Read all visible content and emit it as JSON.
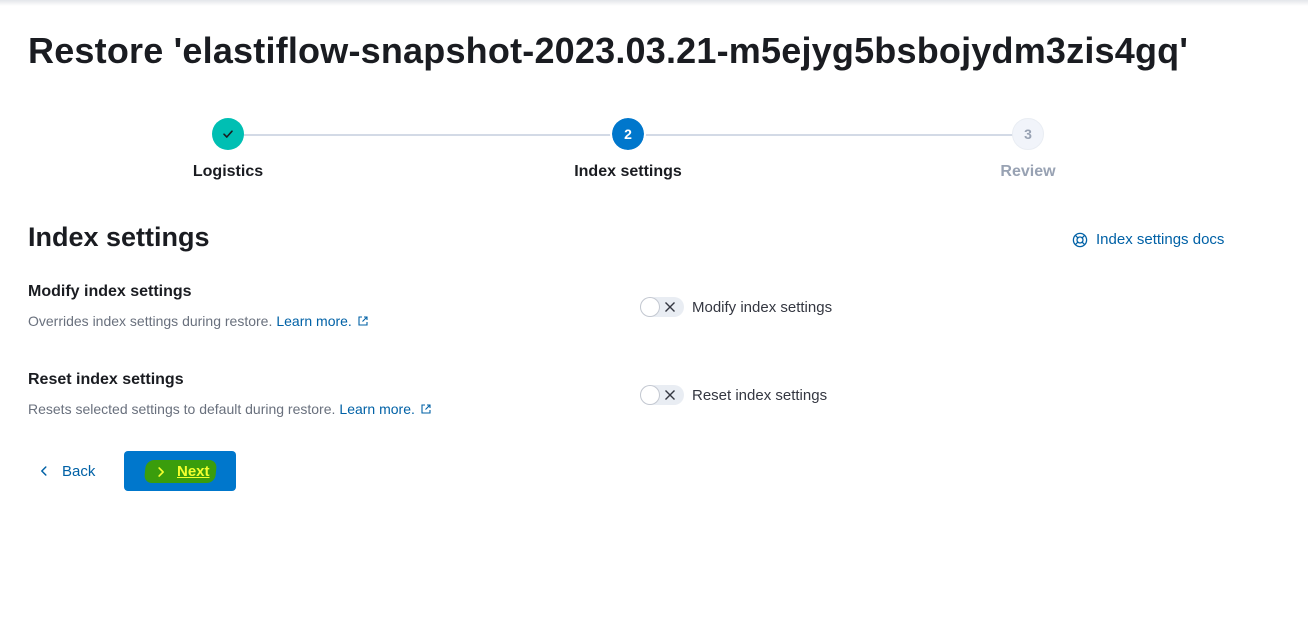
{
  "page": {
    "title": "Restore 'elastiflow-snapshot-2023.03.21-m5ejyg5bsbojydm3zis4gq'"
  },
  "steps": [
    {
      "label": "Logistics",
      "status": "complete",
      "marker": ""
    },
    {
      "label": "Index settings",
      "status": "current",
      "marker": "2"
    },
    {
      "label": "Review",
      "status": "todo",
      "marker": "3"
    }
  ],
  "section": {
    "title": "Index settings",
    "docs_link": "Index settings docs",
    "docs_icon": "lifebuoy-icon"
  },
  "settings": {
    "modify": {
      "title": "Modify index settings",
      "description": "Overrides index settings during restore.",
      "link": "Learn more.",
      "toggle_label": "Modify index settings",
      "enabled": false
    },
    "reset": {
      "title": "Reset index settings",
      "description": "Resets selected settings to default during restore.",
      "link": "Learn more.",
      "toggle_label": "Reset index settings",
      "enabled": false
    }
  },
  "actions": {
    "back_label": "Back",
    "next_label": "Next"
  },
  "colors": {
    "primary": "#0077cc",
    "link": "#0061a6",
    "success": "#00bfb3",
    "highlight": "#3a9d0c",
    "highlight_text": "#f4ff2e"
  }
}
